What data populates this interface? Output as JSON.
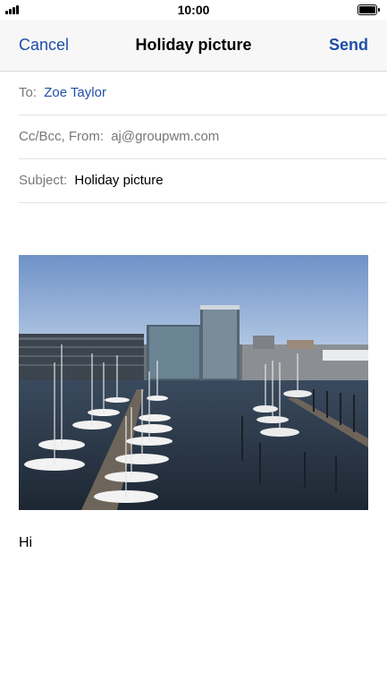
{
  "status": {
    "time": "10:00",
    "signal_icon": "signal-bars-icon",
    "battery_icon": "battery-icon"
  },
  "nav": {
    "cancel": "Cancel",
    "title": "Holiday picture",
    "send": "Send",
    "accent": "#1f4fa8"
  },
  "compose": {
    "to_label": "To:",
    "to_value": "Zoe Taylor",
    "cc_label": "Cc/Bcc, From:",
    "from_value": "aj@groupwm.com",
    "subject_label": "Subject:",
    "subject_value": "Holiday picture"
  },
  "attachment": {
    "image_icon": "harbor-photo"
  },
  "body": {
    "text": "Hi"
  }
}
